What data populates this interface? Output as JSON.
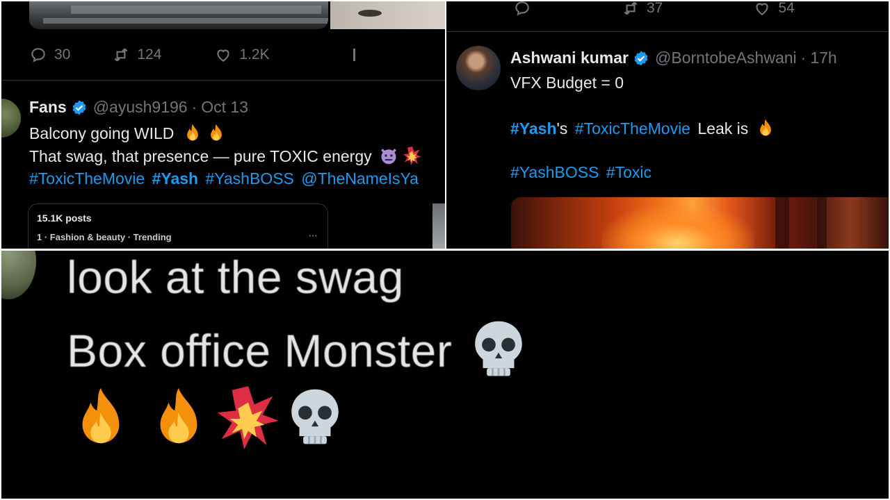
{
  "left_tweet": {
    "actions": {
      "replies": "30",
      "reposts": "124",
      "likes": "1.2K"
    },
    "author": {
      "name": "Fans",
      "handle": "@ayush9196",
      "separator": "·",
      "date": "Oct 13"
    },
    "lines": {
      "line1": "Balcony going WILD",
      "line2": "That swag, that presence — pure TOXIC energy",
      "hashtag1": "#ToxicTheMovie",
      "hashtag2": "#Yash",
      "hashtag3": "#YashBOSS",
      "mention": "@TheNameIsYa"
    },
    "trend_card": {
      "posts": "15.1K posts",
      "rank": "1 · Fashion & beauty · Trending",
      "more": "···"
    }
  },
  "right_tweet": {
    "actions": {
      "reposts": "37",
      "likes": "54"
    },
    "author": {
      "name": "Ashwani kumar",
      "handle": "@BorntobeAshwani",
      "separator": "·",
      "time": "17h"
    },
    "lines": {
      "line1": "VFX Budget = 0",
      "hashtag_yash": "#Yash",
      "possessive": "'s",
      "hashtag_movie": "#ToxicTheMovie",
      "leak_text": "Leak is",
      "hashtag_boss": "#YashBOSS",
      "hashtag_toxic": "#Toxic"
    }
  },
  "zoom_tweet": {
    "line1": "look at the swag",
    "line2": "Box office Monster"
  },
  "colors": {
    "background": "#000000",
    "text": "#e7e9ea",
    "muted": "#71767b",
    "link": "#1d9bf0",
    "verified": "#1d9bf0",
    "divider": "#2f3336"
  },
  "icons": [
    "reply-icon",
    "repost-icon",
    "like-icon",
    "verified-badge-icon",
    "fire-emoji",
    "skull-emoji",
    "collision-emoji",
    "angry-devil-emoji",
    "more-dots-icon"
  ]
}
